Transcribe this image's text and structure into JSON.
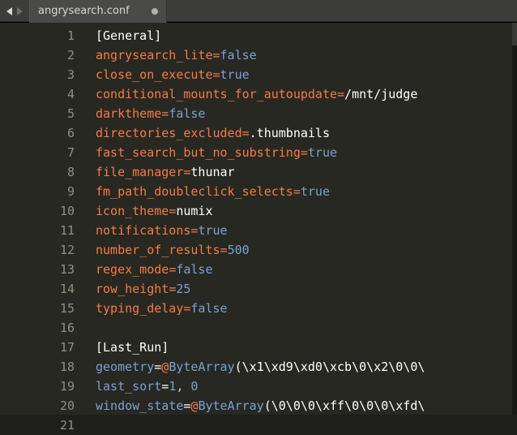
{
  "tab": {
    "name": "angrysearch.conf",
    "dirty": true
  },
  "lines": 21,
  "code": {
    "1": {
      "section": "[General]"
    },
    "2": {
      "key": "angrysearch_lite",
      "bool": "false"
    },
    "3": {
      "key": "close_on_execute",
      "bool": "true"
    },
    "4": {
      "key": "conditional_mounts_for_autoupdate",
      "val": "/mnt/judge"
    },
    "5": {
      "key": "darktheme",
      "bool": "false"
    },
    "6": {
      "key": "directories_excluded",
      "val": ".thumbnails"
    },
    "7": {
      "key": "fast_search_but_no_substring",
      "bool": "true"
    },
    "8": {
      "key": "file_manager",
      "val": "thunar"
    },
    "9": {
      "key": "fm_path_doubleclick_selects",
      "bool": "true"
    },
    "10": {
      "key": "icon_theme",
      "val": "numix"
    },
    "11": {
      "key": "notifications",
      "bool": "true"
    },
    "12": {
      "key": "number_of_results",
      "num": "500"
    },
    "13": {
      "key": "regex_mode",
      "bool": "false"
    },
    "14": {
      "key": "row_height",
      "num": "25"
    },
    "15": {
      "key": "typing_delay",
      "bool": "false"
    },
    "16": {
      "blank": true
    },
    "17": {
      "section": "[Last_Run]"
    },
    "18": {
      "bkey": "geometry",
      "fn": "ByteArray",
      "arg": "\\x1\\xd9\\xd0\\xcb\\0\\x2\\0\\0\\"
    },
    "19": {
      "bkey": "last_sort",
      "args": [
        "1",
        "0"
      ]
    },
    "20": {
      "bkey": "window_state",
      "fn": "ByteArray",
      "arg": "\\0\\0\\0\\xff\\0\\0\\0\\xfd\\"
    },
    "21": {
      "blank": true
    }
  }
}
